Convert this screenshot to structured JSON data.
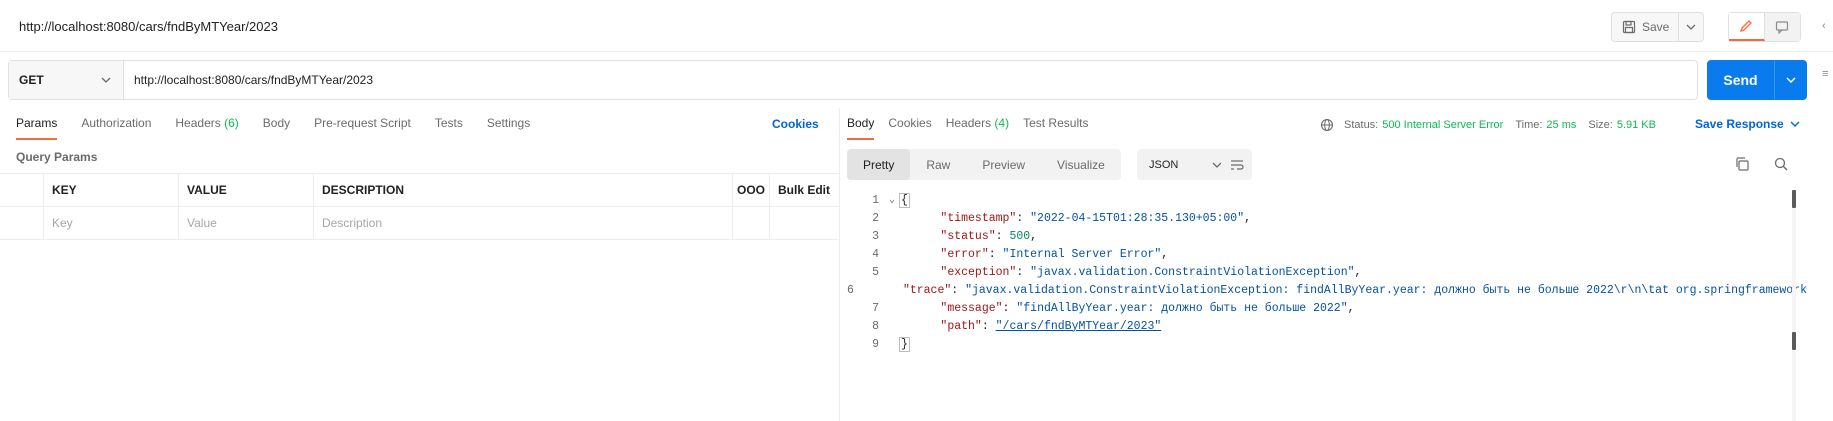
{
  "request": {
    "title": "http://localhost:8080/cars/fndByMTYear/2023",
    "save_label": "Save",
    "method": "GET",
    "url": "http://localhost:8080/cars/fndByMTYear/2023",
    "send_label": "Send"
  },
  "request_tabs": {
    "items": [
      {
        "label": "Params",
        "count": "",
        "active": true
      },
      {
        "label": "Authorization",
        "count": "",
        "active": false
      },
      {
        "label": "Headers",
        "count": "(6)",
        "active": false
      },
      {
        "label": "Body",
        "count": "",
        "active": false
      },
      {
        "label": "Pre-request Script",
        "count": "",
        "active": false
      },
      {
        "label": "Tests",
        "count": "",
        "active": false
      },
      {
        "label": "Settings",
        "count": "",
        "active": false
      }
    ],
    "cookies_label": "Cookies"
  },
  "params": {
    "section_label": "Query Params",
    "headers": [
      "KEY",
      "VALUE",
      "DESCRIPTION"
    ],
    "dots": "ooo",
    "bulk_edit": "Bulk Edit",
    "placeholders": {
      "key": "Key",
      "value": "Value",
      "description": "Description"
    }
  },
  "response_tabs": {
    "items": [
      {
        "label": "Body",
        "count": "",
        "active": true
      },
      {
        "label": "Cookies",
        "count": "",
        "active": false
      },
      {
        "label": "Headers",
        "count": "(4)",
        "active": false
      },
      {
        "label": "Test Results",
        "count": "",
        "active": false
      }
    ]
  },
  "response_status": {
    "status_label": "Status:",
    "status_value": "500 Internal Server Error",
    "time_label": "Time:",
    "time_value": "25 ms",
    "size_label": "Size:",
    "size_value": "5.91 KB",
    "save_response": "Save Response"
  },
  "format": {
    "options": [
      "Pretty",
      "Raw",
      "Preview",
      "Visualize"
    ],
    "active": "Pretty",
    "language": "JSON"
  },
  "body_lines": [
    {
      "n": "1",
      "k": "",
      "v": "",
      "raw": "{"
    },
    {
      "n": "2",
      "k": "\"timestamp\"",
      "v": "\"2022-04-15T01:28:35.130+05:00\"",
      "t": "s",
      "raw": ""
    },
    {
      "n": "3",
      "k": "\"status\"",
      "v": "500",
      "t": "n",
      "raw": ""
    },
    {
      "n": "4",
      "k": "\"error\"",
      "v": "\"Internal Server Error\"",
      "t": "s",
      "raw": ""
    },
    {
      "n": "5",
      "k": "\"exception\"",
      "v": "\"javax.validation.ConstraintViolationException\"",
      "t": "s",
      "raw": ""
    },
    {
      "n": "6",
      "k": "\"trace\"",
      "v": "\"javax.validation.ConstraintViolationException: findAllByYear.year: должно быть не больше 2022\\r\\n\\tat org.springframework",
      "t": "s",
      "raw": ""
    },
    {
      "n": "7",
      "k": "\"message\"",
      "v": "\"findAllByYear.year: должно быть не больше 2022\"",
      "t": "s",
      "raw": ""
    },
    {
      "n": "8",
      "k": "\"path\"",
      "v": "\"/cars/fndByMTYear/2023\"",
      "t": "link",
      "raw": ""
    },
    {
      "n": "9",
      "k": "",
      "v": "",
      "raw": "}"
    }
  ],
  "icons": {
    "save": "save-icon",
    "edit": "pencil-icon",
    "comment": "comment-icon",
    "globe": "globe-icon",
    "copy": "copy-icon",
    "search": "search-icon",
    "wrap": "wrap-lines-icon"
  },
  "colors": {
    "accent": "#f26b3a",
    "send": "#097bed",
    "link": "#0265d2",
    "success_green": "#0cbb52"
  }
}
